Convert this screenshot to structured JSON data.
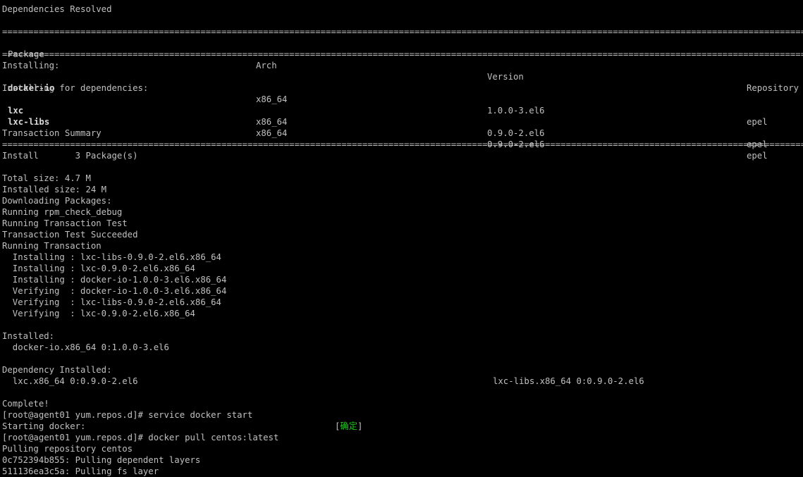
{
  "header": {
    "title": "Dependencies Resolved"
  },
  "rule_char": "==================================================================================================================================================================================================================================",
  "table": {
    "headers": {
      "package": "Package",
      "arch": "Arch",
      "version": "Version",
      "repository": "Repository"
    },
    "installing_label": "Installing:",
    "deps_label": "Installing for dependencies:",
    "rows": [
      {
        "package": "docker-io",
        "arch": "x86_64",
        "version": "1.0.0-3.el6",
        "repository": "epel"
      },
      {
        "package": "lxc",
        "arch": "x86_64",
        "version": "0.9.0-2.el6",
        "repository": "epel"
      },
      {
        "package": "lxc-libs",
        "arch": "x86_64",
        "version": "0.9.0-2.el6",
        "repository": "epel"
      }
    ]
  },
  "summary": {
    "title": "Transaction Summary",
    "install_line": "Install       3 Package(s)"
  },
  "log": [
    "Total size: 4.7 M",
    "Installed size: 24 M",
    "Downloading Packages:",
    "Running rpm_check_debug",
    "Running Transaction Test",
    "Transaction Test Succeeded",
    "Running Transaction",
    "  Installing : lxc-libs-0.9.0-2.el6.x86_64",
    "  Installing : lxc-0.9.0-2.el6.x86_64",
    "  Installing : docker-io-1.0.0-3.el6.x86_64",
    "  Verifying  : docker-io-1.0.0-3.el6.x86_64",
    "  Verifying  : lxc-libs-0.9.0-2.el6.x86_64",
    "  Verifying  : lxc-0.9.0-2.el6.x86_64"
  ],
  "installed": {
    "label": "Installed:",
    "item": "  docker-io.x86_64 0:1.0.0-3.el6"
  },
  "dependency_installed": {
    "label": "Dependency Installed:",
    "left": "  lxc.x86_64 0:0.9.0-2.el6",
    "right": "lxc-libs.x86_64 0:0.9.0-2.el6"
  },
  "tail": {
    "complete": "Complete!",
    "cmd1": "[root@agent01 yum.repos.d]# service docker start",
    "starting": "Starting docker:",
    "ok_open": "[",
    "ok_text": "确定",
    "ok_close": "]",
    "cmd2": "[root@agent01 yum.repos.d]# docker pull centos:latest",
    "pulling": "Pulling repository centos",
    "layer1": "0c752394b855: Pulling dependent layers",
    "layer2": "511136ea3c5a: Pulling fs layer"
  },
  "colors": {
    "background": "#000000",
    "text": "#c0c0c0",
    "ok": "#22c322"
  }
}
